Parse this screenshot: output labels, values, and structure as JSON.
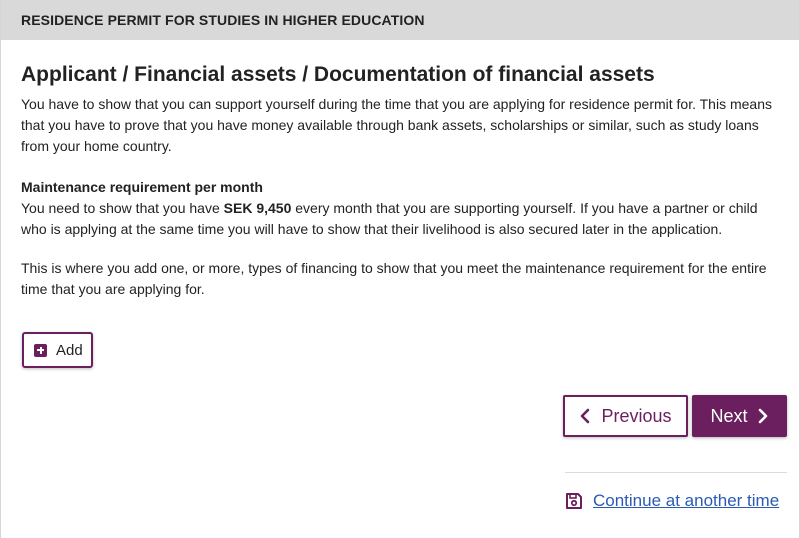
{
  "header": {
    "title": "RESIDENCE PERMIT FOR STUDIES IN HIGHER EDUCATION"
  },
  "main": {
    "page_title": "Applicant / Financial assets / Documentation of financial assets",
    "intro": "You have to show that you can support yourself during the time that you are applying for residence permit for. This means that you have to prove that you have money available through bank assets, scholarships or similar, such as study loans from your home country.",
    "maintenance_heading": "Maintenance requirement per month",
    "maintenance_text_before": "You need to show that you have ",
    "maintenance_amount": "SEK 9,450",
    "maintenance_text_after": " every month that you are supporting yourself. If you have a partner or child who is applying at the same time you will have to show that their livelihood is also secured later in the application.",
    "financing_text": "This is where you add one, or more, types of financing to show that you meet the maintenance requirement for the entire time that you are applying for."
  },
  "actions": {
    "add_label": "Add",
    "previous_label": "Previous",
    "next_label": "Next",
    "continue_label": "Continue at another time"
  },
  "icons": {
    "add": "plus-square-icon",
    "previous": "chevron-left-icon",
    "next": "chevron-right-icon",
    "continue": "floppy-disk-icon"
  },
  "colors": {
    "brand": "#6b1f5e",
    "header_bg": "#d9d9d9",
    "link": "#2a5bb3"
  }
}
